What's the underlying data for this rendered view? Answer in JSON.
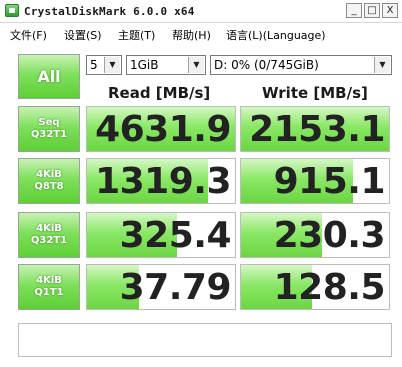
{
  "window": {
    "title": "CrystalDiskMark 6.0.0 x64",
    "buttons": {
      "minimize": "_",
      "maximize": "□",
      "close": "X"
    }
  },
  "menu": [
    {
      "label": "文件(F)"
    },
    {
      "label": "设置(S)"
    },
    {
      "label": "主题(T)"
    },
    {
      "label": "帮助(H)"
    },
    {
      "label": "语言(L)(Language)"
    }
  ],
  "controls": {
    "all_label": "All",
    "count_value": "5",
    "size_value": "1GiB",
    "drive_value": "D: 0% (0/745GiB)"
  },
  "headers": {
    "read": "Read [MB/s]",
    "write": "Write [MB/s]"
  },
  "tests": [
    {
      "line1": "Seq",
      "line2": "Q32T1",
      "read": "4631.9",
      "write": "2153.1",
      "read_fill": 1.0,
      "write_fill": 1.0
    },
    {
      "line1": "4KiB",
      "line2": "Q8T8",
      "read": "1319.3",
      "write": "915.1",
      "read_fill": 0.82,
      "write_fill": 0.76
    },
    {
      "line1": "4KiB",
      "line2": "Q32T1",
      "read": "325.4",
      "write": "230.3",
      "read_fill": 0.61,
      "write_fill": 0.55
    },
    {
      "line1": "4KiB",
      "line2": "Q1T1",
      "read": "37.79",
      "write": "128.5",
      "read_fill": 0.35,
      "write_fill": 0.48
    }
  ],
  "status_text": ""
}
